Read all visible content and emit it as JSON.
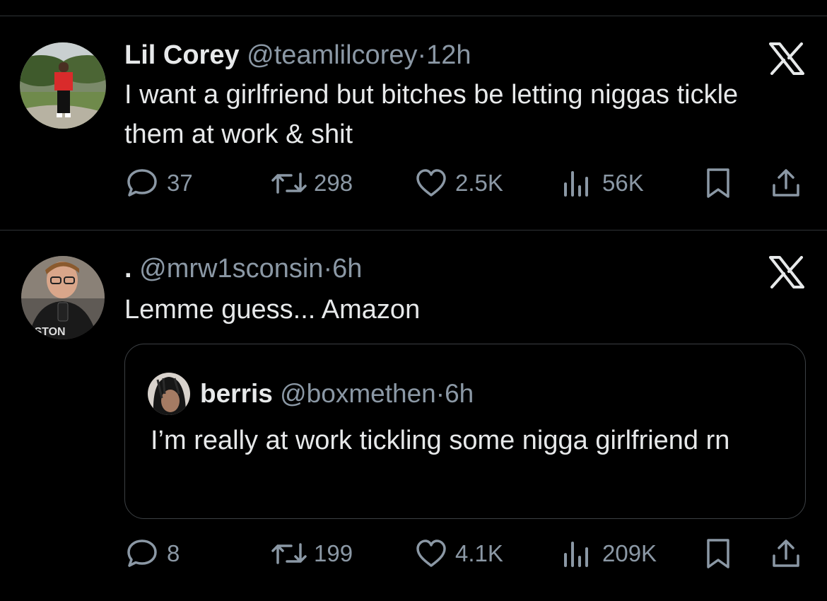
{
  "tweet1": {
    "name": "Lil Corey",
    "handle": "@teamlilcorey",
    "separator": "·",
    "time": "12h",
    "text": "I want a girlfriend but bitches be letting niggas tickle them at work & shit",
    "replies": "37",
    "retweets": "298",
    "likes": "2.5K",
    "views": "56K"
  },
  "tweet2": {
    "name": ".",
    "handle": "@mrw1sconsin",
    "separator": "·",
    "time": "6h",
    "text": "Lemme guess... Amazon",
    "replies": "8",
    "retweets": "199",
    "likes": "4.1K",
    "views": "209K"
  },
  "quoted": {
    "name": "berris",
    "handle": "@boxmethen",
    "separator": "·",
    "time": "6h",
    "text": "I’m really at work tickling some nigga girlfriend rn"
  },
  "icons": {
    "platform_logo": "x-logo-icon",
    "reply": "reply-bubble-icon",
    "retweet": "retweet-icon",
    "like": "heart-icon",
    "views": "views-bar-icon",
    "bookmark": "bookmark-icon",
    "share": "share-icon"
  },
  "colors": {
    "background": "#000000",
    "text": "#e7e9ea",
    "secondary": "#8b98a5",
    "divider": "#2f3336"
  }
}
